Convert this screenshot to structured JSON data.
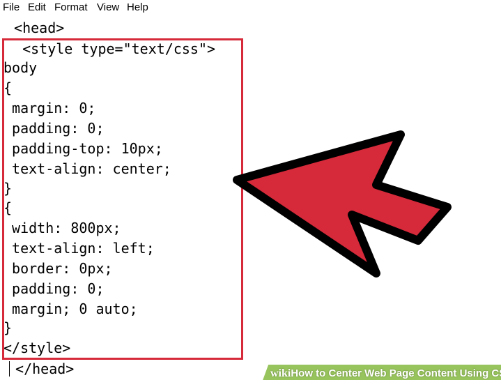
{
  "menubar": {
    "items": [
      {
        "label": "File"
      },
      {
        "label": "Edit"
      },
      {
        "label": "Format"
      },
      {
        "label": "View"
      },
      {
        "label": "Help"
      }
    ]
  },
  "editor": {
    "lines": [
      " <head>",
      "  <style type=\"text/css\">",
      "body",
      "{",
      " margin: 0;",
      " padding: 0;",
      " padding-top: 10px;",
      " text-align: center;",
      "}",
      "{",
      " width: 800px;",
      " text-align: left;",
      " border: 0px;",
      " padding: 0;",
      " margin; 0 auto;",
      "}",
      "</style>",
      " </head>"
    ]
  },
  "annotation": {
    "highlight_color": "#d6293a",
    "arrow_color": "#d6293a",
    "arrow_outline_color": "#000000",
    "arrow_icon": "arrow-pointing-left"
  },
  "watermark": {
    "brand": "wiki",
    "title": "How to Center Web Page Content Using CSS",
    "background_color": "#8fbf4f"
  }
}
